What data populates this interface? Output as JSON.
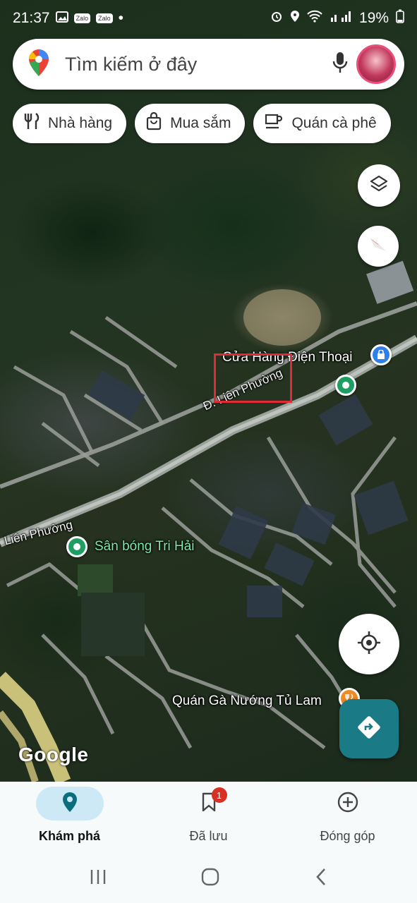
{
  "status_bar": {
    "time": "21:37",
    "battery": "19%",
    "app_badges": [
      "Zalo",
      "Zalo"
    ]
  },
  "search": {
    "placeholder": "Tìm kiếm ở đây"
  },
  "chips": [
    {
      "label": "Nhà hàng",
      "icon": "restaurant-icon"
    },
    {
      "label": "Mua sắm",
      "icon": "shopping-bag-icon"
    },
    {
      "label": "Quán cà phê",
      "icon": "coffee-icon"
    }
  ],
  "map": {
    "pois": {
      "phone_shop": "Cửa Hàng Điện Thoại",
      "football_field": "Sân bóng Tri Hải",
      "chicken_restaurant": "Quán Gà Nướng Tủ Lam"
    },
    "roads": {
      "main": "Đ. Liên Phường",
      "left": "Liên Phường"
    },
    "attribution": "Google"
  },
  "bottom_nav": [
    {
      "label": "Khám phá",
      "icon": "explore-pin-icon",
      "active": true
    },
    {
      "label": "Đã lưu",
      "icon": "bookmark-icon",
      "badge": "1"
    },
    {
      "label": "Đóng góp",
      "icon": "add-circle-icon"
    }
  ],
  "colors": {
    "accent_blue": "#1a7b86",
    "highlight_red": "#e02b36",
    "active_nav_bg": "#cde9f5"
  }
}
